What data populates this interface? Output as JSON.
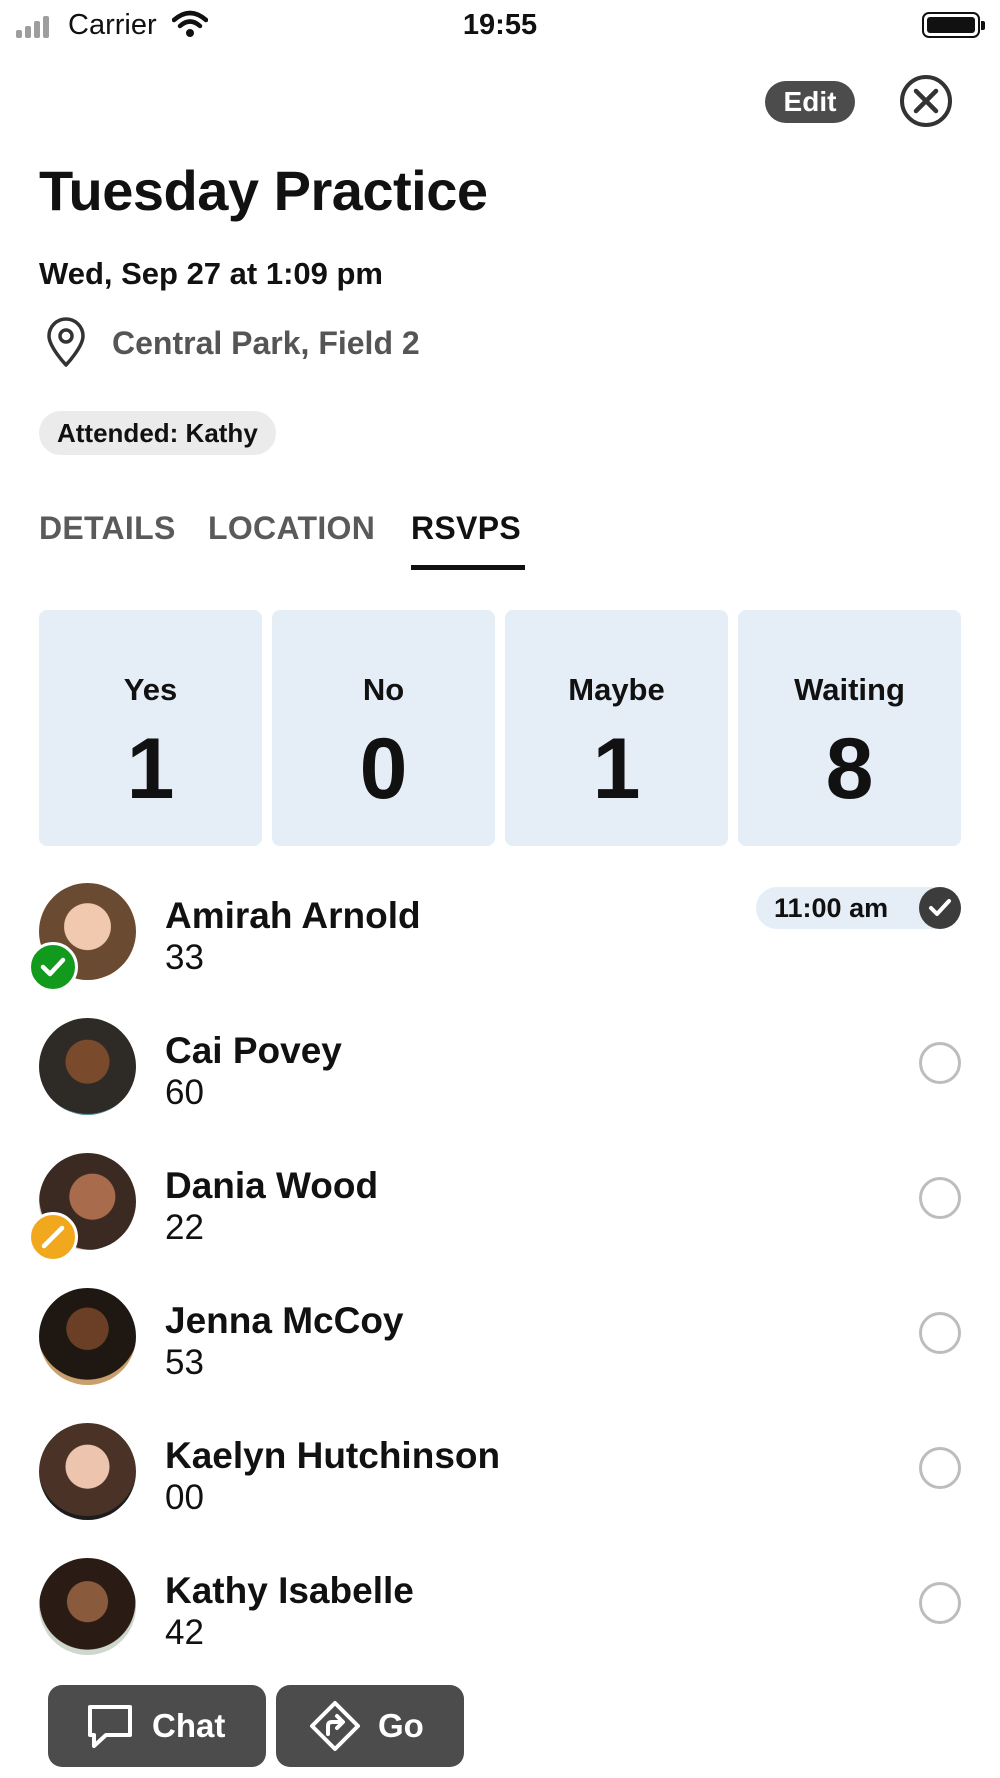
{
  "status_bar": {
    "carrier": "Carrier",
    "time": "19:55",
    "icons": [
      "cellular-signal-icon",
      "wifi-icon",
      "battery-icon"
    ]
  },
  "header": {
    "edit_label": "Edit",
    "close_icon": "close-circle-icon"
  },
  "event": {
    "title": "Tuesday Practice",
    "datetime": "Wed, Sep 27 at 1:09 pm",
    "location": "Central Park, Field 2",
    "location_icon": "map-pin-icon",
    "attended_label": "Attended: Kathy"
  },
  "tabs": [
    {
      "label": "DETAILS",
      "active": false
    },
    {
      "label": "LOCATION",
      "active": false
    },
    {
      "label": "RSVPS",
      "active": true
    }
  ],
  "rsvp_counts": [
    {
      "label": "Yes",
      "value": "1"
    },
    {
      "label": "No",
      "value": "0"
    },
    {
      "label": "Maybe",
      "value": "1"
    },
    {
      "label": "Waiting",
      "value": "8"
    }
  ],
  "members": [
    {
      "name": "Amirah Arnold",
      "number": "33",
      "status": "yes",
      "time": "11:00 am",
      "checked": true
    },
    {
      "name": "Cai Povey",
      "number": "60",
      "status": "",
      "checked": false
    },
    {
      "name": "Dania Wood",
      "number": "22",
      "status": "maybe",
      "checked": false
    },
    {
      "name": "Jenna McCoy",
      "number": "53",
      "status": "",
      "checked": false
    },
    {
      "name": "Kaelyn Hutchinson",
      "number": "00",
      "status": "",
      "checked": false
    },
    {
      "name": "Kathy Isabelle",
      "number": "42",
      "status": "",
      "checked": false
    }
  ],
  "actions": {
    "chat_label": "Chat",
    "go_label": "Go"
  },
  "colors": {
    "card_background": "#e5edf6",
    "dark_button": "#4c4c4c",
    "yes_status": "#129a1d",
    "maybe_status": "#f2a81d",
    "empty_circle": "#bdbdbd"
  }
}
